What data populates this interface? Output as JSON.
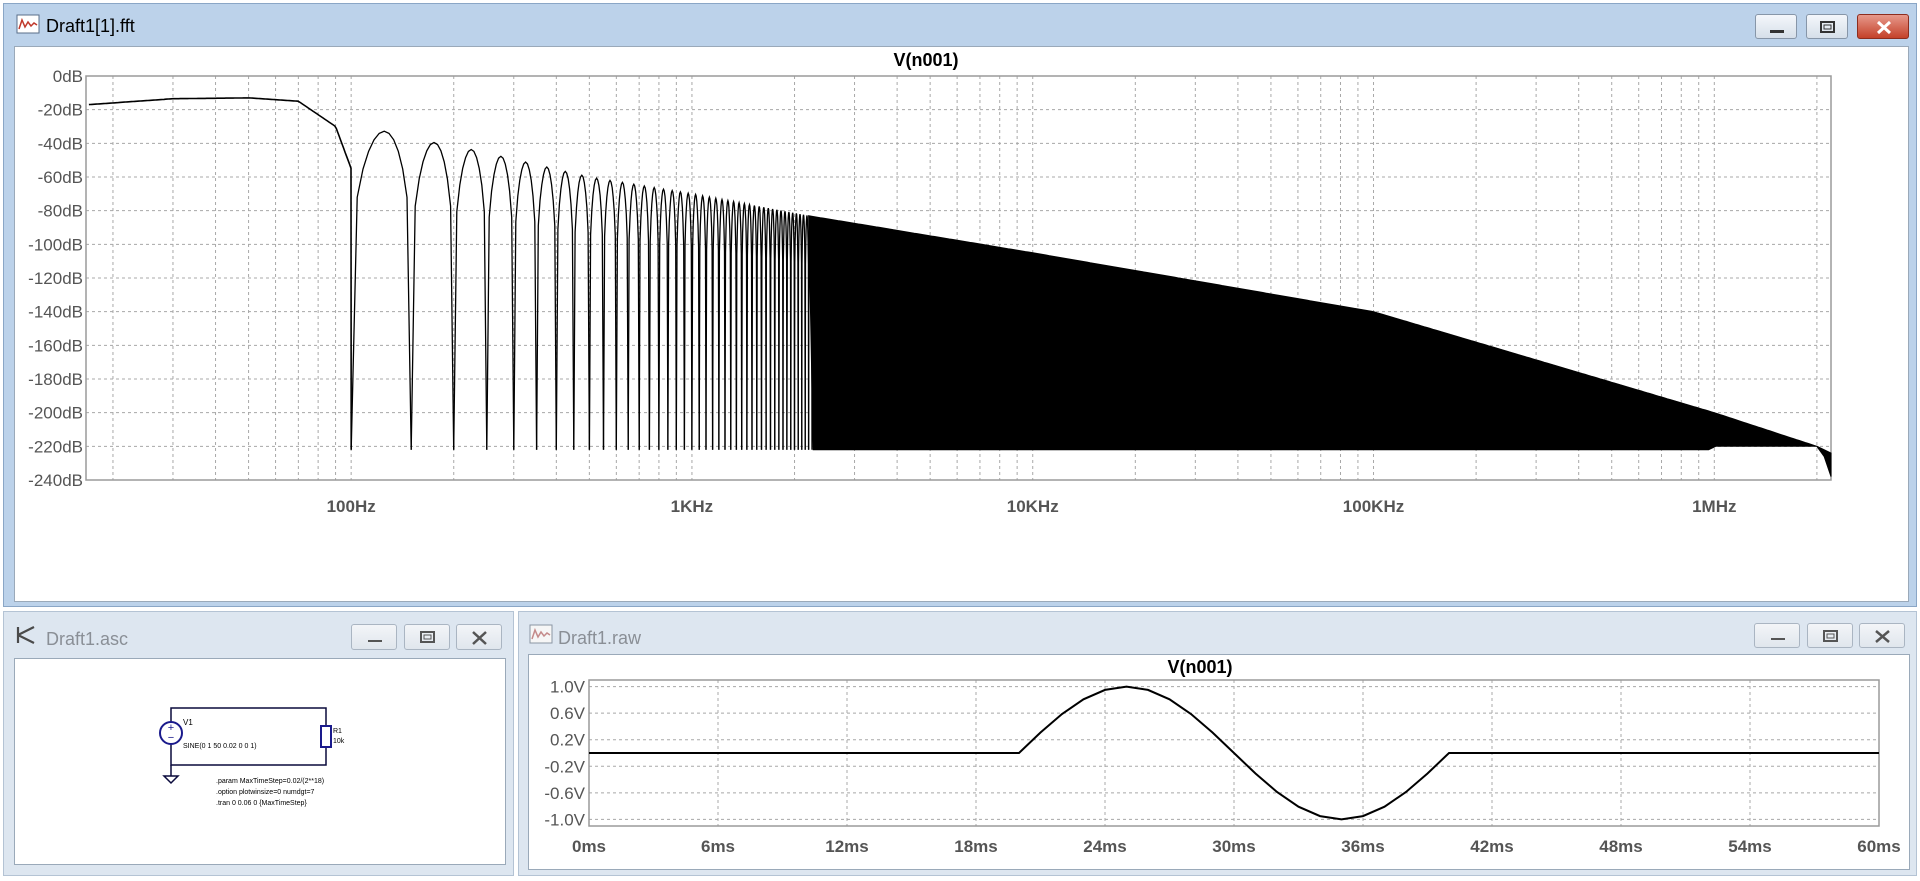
{
  "fft_window": {
    "title": "Draft1[1].fft",
    "plot_title": "V(n001)",
    "y_tick_labels": [
      "0dB",
      "-20dB",
      "-40dB",
      "-60dB",
      "-80dB",
      "-100dB",
      "-120dB",
      "-140dB",
      "-160dB",
      "-180dB",
      "-200dB",
      "-220dB",
      "-240dB"
    ],
    "x_tick_labels": [
      "100Hz",
      "1KHz",
      "10KHz",
      "100KHz",
      "1MHz"
    ]
  },
  "schematic_window": {
    "title": "Draft1.asc",
    "source_label": "V1",
    "source_value": "SINE(0 1 50 0.02 0 0 1)",
    "resistor_label": "R1",
    "resistor_value": "10k",
    "directives": [
      ".param MaxTimeStep=0.02/(2**18)",
      ".option plotwinsize=0 numdgt=7",
      ".tran 0 0.06 0 {MaxTimeStep}"
    ]
  },
  "raw_window": {
    "title": "Draft1.raw",
    "plot_title": "V(n001)",
    "y_tick_labels": [
      "1.0V",
      "0.6V",
      "0.2V",
      "-0.2V",
      "-0.6V",
      "-1.0V"
    ],
    "x_tick_labels": [
      "0ms",
      "6ms",
      "12ms",
      "18ms",
      "24ms",
      "30ms",
      "36ms",
      "42ms",
      "48ms",
      "54ms",
      "60ms"
    ]
  },
  "chart_data": [
    {
      "type": "line",
      "title": "V(n001)",
      "x_scale": "log",
      "xlim_hz": [
        16.67,
        2200000
      ],
      "ylim_db": [
        -240,
        0
      ],
      "grid": true,
      "series": [
        {
          "name": "V(n001)",
          "envelope_points": [
            {
              "x_hz": 17,
              "y_db": -17
            },
            {
              "x_hz": 30,
              "y_db": -13.5
            },
            {
              "x_hz": 50,
              "y_db": -13
            },
            {
              "x_hz": 70,
              "y_db": -15
            },
            {
              "x_hz": 90,
              "y_db": -30
            },
            {
              "x_hz": 100,
              "y_db": -55
            },
            {
              "x_hz": 120,
              "y_db": -32
            },
            {
              "x_hz": 170,
              "y_db": -39
            },
            {
              "x_hz": 230,
              "y_db": -44
            },
            {
              "x_hz": 500,
              "y_db": -60
            },
            {
              "x_hz": 1000,
              "y_db": -70
            },
            {
              "x_hz": 2200,
              "y_db": -83
            },
            {
              "x_hz": 10000,
              "y_db": -105
            },
            {
              "x_hz": 100000,
              "y_db": -140
            },
            {
              "x_hz": 1000000,
              "y_db": -200
            },
            {
              "x_hz": 2000000,
              "y_db": -220
            }
          ],
          "notch_floor_db": -222
        }
      ]
    },
    {
      "type": "line",
      "title": "V(n001)",
      "xlim_ms": [
        0,
        60
      ],
      "ylim_v": [
        -1.1,
        1.1
      ],
      "grid": true,
      "series": [
        {
          "name": "V(n001)",
          "x_ms": [
            0,
            20,
            21,
            22,
            23,
            24,
            25,
            26,
            27,
            28,
            29,
            30,
            31,
            32,
            33,
            34,
            35,
            36,
            37,
            38,
            39,
            40,
            60
          ],
          "y_v": [
            0,
            0,
            0.309,
            0.588,
            0.809,
            0.951,
            1.0,
            0.951,
            0.809,
            0.588,
            0.309,
            0,
            -0.309,
            -0.588,
            -0.809,
            -0.951,
            -1.0,
            -0.951,
            -0.809,
            -0.588,
            -0.309,
            0,
            0
          ]
        }
      ]
    }
  ]
}
